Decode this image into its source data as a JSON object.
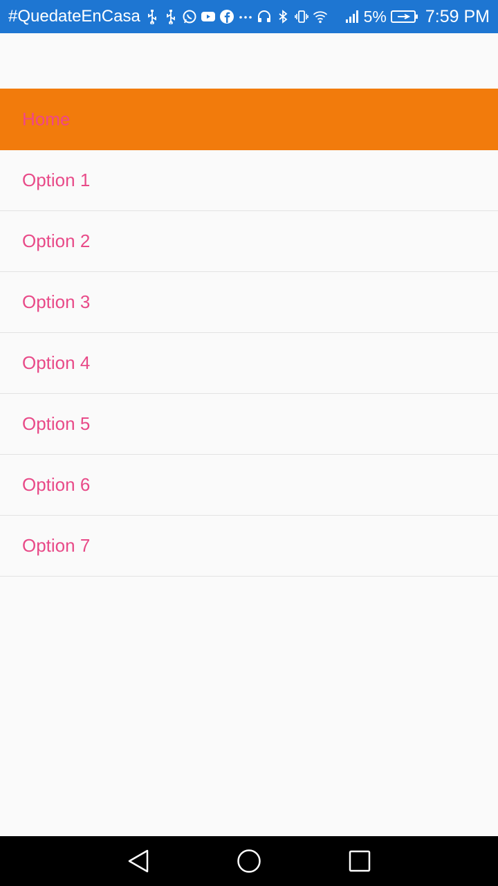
{
  "status_bar": {
    "carrier_text": "#QuedateEnCasa",
    "battery_percent": "5%",
    "time": "7:59 PM",
    "icons": [
      "usb-icon",
      "usb-icon",
      "whatsapp-icon",
      "youtube-icon",
      "facebook-icon",
      "more-notifications-icon",
      "headset-icon",
      "bluetooth-icon",
      "vibrate-icon",
      "wifi-icon",
      "signal-icon",
      "battery-charging-icon"
    ],
    "background_color": "#1e76d2"
  },
  "menu": {
    "active_color": "#f27b0c",
    "text_color": "#e84a88",
    "items": [
      {
        "label": "Home",
        "active": true
      },
      {
        "label": "Option 1",
        "active": false
      },
      {
        "label": "Option 2",
        "active": false
      },
      {
        "label": "Option 3",
        "active": false
      },
      {
        "label": "Option 4",
        "active": false
      },
      {
        "label": "Option 5",
        "active": false
      },
      {
        "label": "Option 6",
        "active": false
      },
      {
        "label": "Option 7",
        "active": false
      }
    ]
  },
  "nav_bar": {
    "buttons": [
      "back-icon",
      "home-icon",
      "recents-icon"
    ]
  }
}
